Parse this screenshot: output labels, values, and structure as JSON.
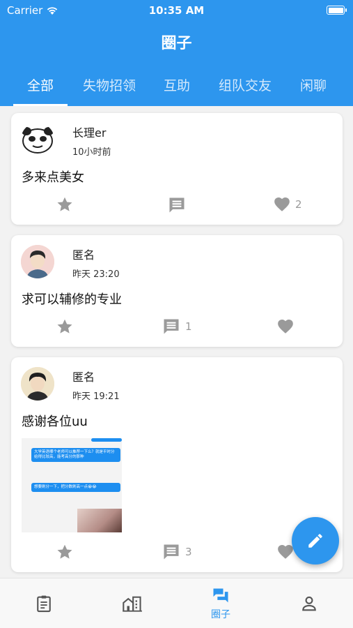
{
  "status_bar": {
    "carrier": "Carrier",
    "time": "10:35 AM"
  },
  "header": {
    "title": "圈子"
  },
  "tabs": [
    {
      "label": "全部",
      "active": true
    },
    {
      "label": "失物招领",
      "active": false
    },
    {
      "label": "互助",
      "active": false
    },
    {
      "label": "组队交友",
      "active": false
    },
    {
      "label": "闲聊",
      "active": false
    }
  ],
  "posts": [
    {
      "author": "长理er",
      "time": "10小时前",
      "content": "多来点美女",
      "comments": "",
      "likes": "2"
    },
    {
      "author": "匿名",
      "time": "昨天 23:20",
      "content": "求可以辅修的专业",
      "comments": "1",
      "likes": ""
    },
    {
      "author": "匿名",
      "time": "昨天 19:21",
      "content": "感谢各位uu",
      "comments": "3",
      "likes": "",
      "image_messages": [
        "大学英语哪个老师可以推荐一下么？就是平时分给得比较高，能考高分的那种",
        "想要刷分一下，把分数刷高一点😭😭"
      ]
    }
  ],
  "bottom_nav": [
    {
      "icon": "clipboard-icon",
      "label": ""
    },
    {
      "icon": "buildings-icon",
      "label": ""
    },
    {
      "icon": "chat-bubbles-icon",
      "label": "圈子",
      "active": true
    },
    {
      "icon": "person-icon",
      "label": ""
    }
  ],
  "colors": {
    "primary": "#2d96ee",
    "icon_gray": "#9a9a9a"
  }
}
